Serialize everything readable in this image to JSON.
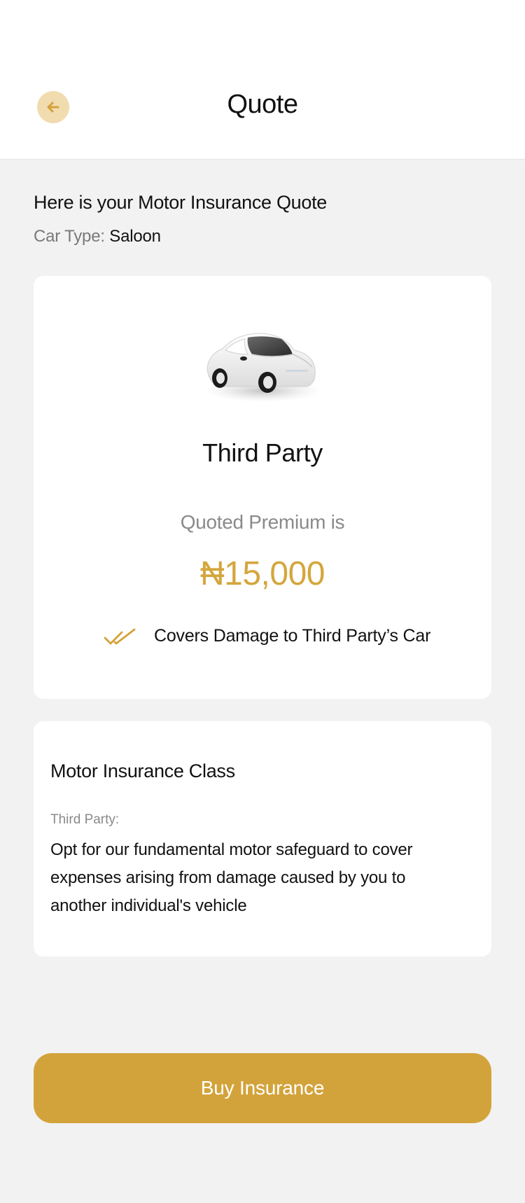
{
  "header": {
    "title": "Quote",
    "back_icon": "arrow-left-icon"
  },
  "intro": {
    "heading": "Here is your Motor Insurance Quote",
    "car_type_label": "Car Type:",
    "car_type_value": "Saloon"
  },
  "quote_card": {
    "image": "car-icon",
    "plan_name": "Third Party",
    "premium_label": "Quoted Premium is",
    "premium_amount": "₦15,000",
    "coverage_icon": "double-check-icon",
    "coverage_text": "Covers Damage to Third Party’s Car"
  },
  "class_card": {
    "title": "Motor Insurance Class",
    "subtitle": "Third Party:",
    "description": "Opt for our fundamental motor safeguard to cover expenses arising from damage caused by you to another individual's vehicle"
  },
  "cta": {
    "buy_label": "Buy Insurance"
  },
  "colors": {
    "accent": "#d3a33b",
    "accent_light": "#f1dcb0",
    "background": "#f2f2f2",
    "card": "#ffffff"
  }
}
